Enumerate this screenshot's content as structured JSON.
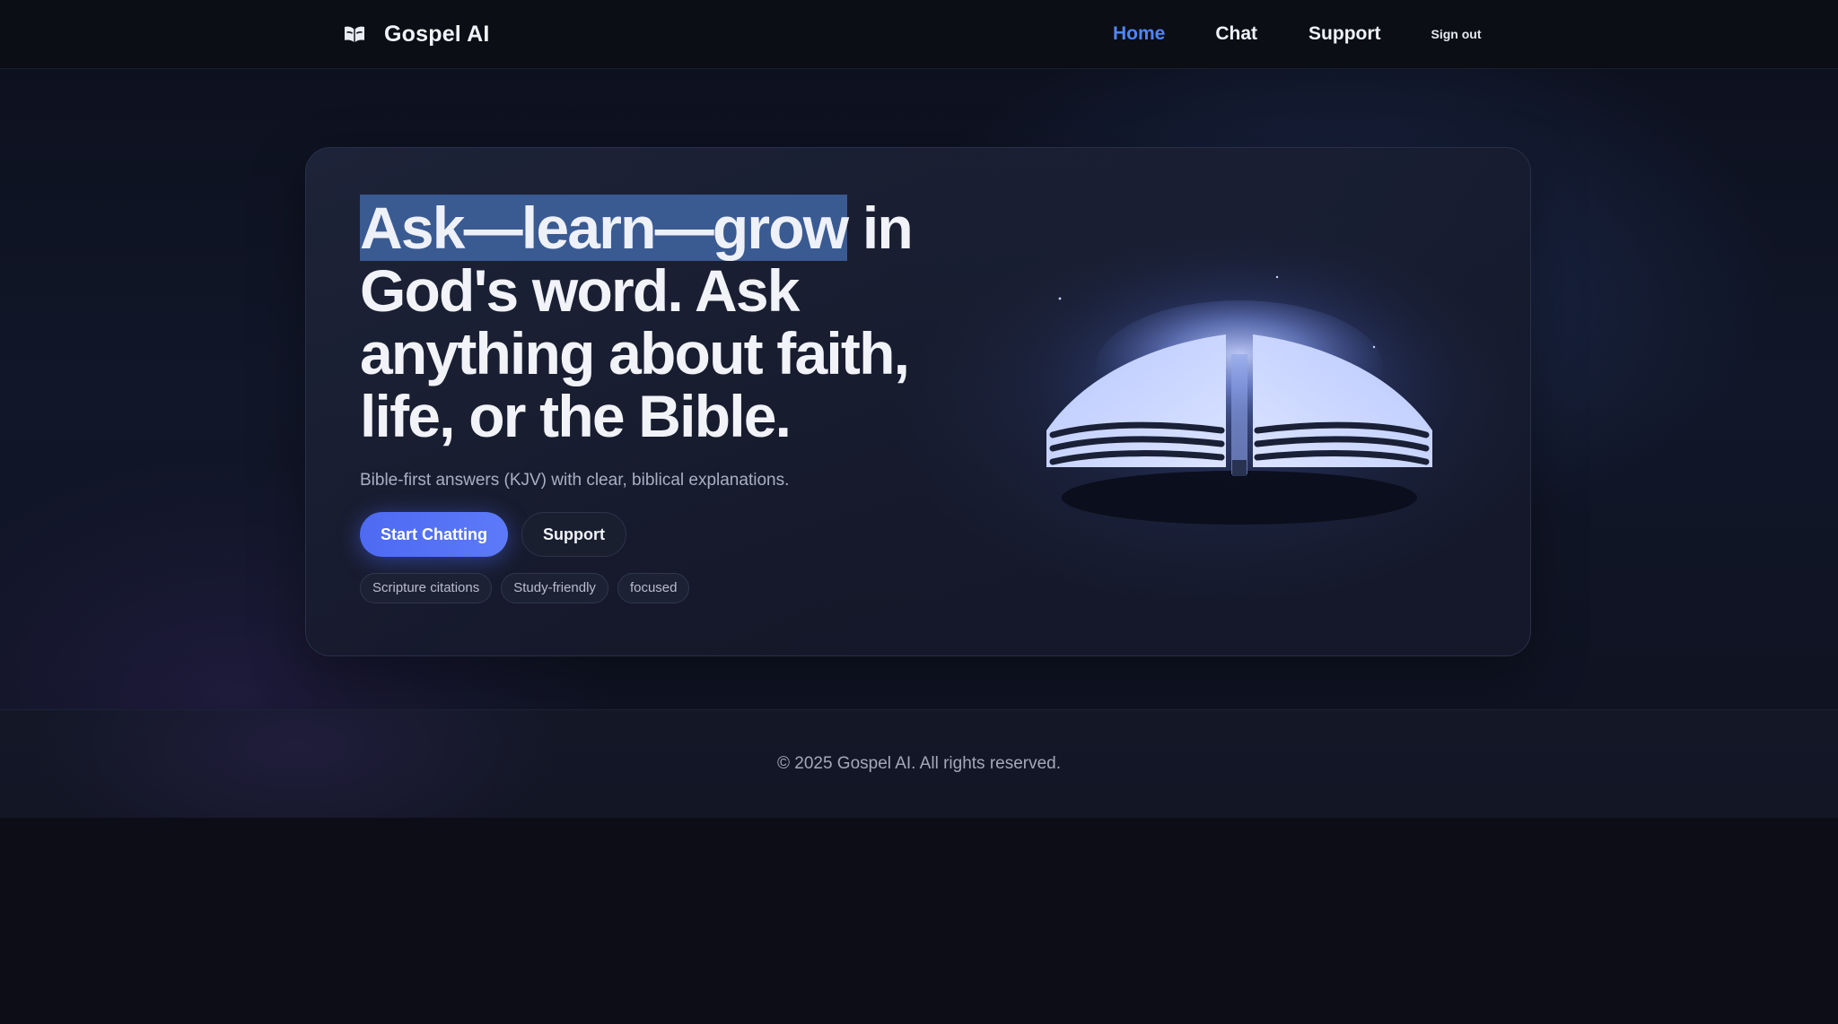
{
  "header": {
    "brand": {
      "name": "Gospel AI",
      "icon": "open-book-icon"
    },
    "nav": {
      "home": "Home",
      "chat": "Chat",
      "support": "Support",
      "sign_out": "Sign out",
      "active": "Home"
    }
  },
  "hero": {
    "title_highlight": "Ask—learn—grow",
    "title_rest": " in God's word. Ask anything about faith, life, or the Bible.",
    "subtitle": "Bible-first answers (KJV) with clear, biblical explanations.",
    "buttons": {
      "primary": "Start Chatting",
      "secondary": "Support"
    },
    "chips": [
      "Scripture citations",
      "Study-friendly",
      "focused"
    ],
    "illustration": "glowing-open-bible-illustration"
  },
  "footer": {
    "copyright": "© 2025 Gospel AI. All rights reserved."
  },
  "colors": {
    "accent": "#4f86f7",
    "primary_button": "#5570f4",
    "highlight": "#3a5a92",
    "background": "#0b0d16"
  }
}
